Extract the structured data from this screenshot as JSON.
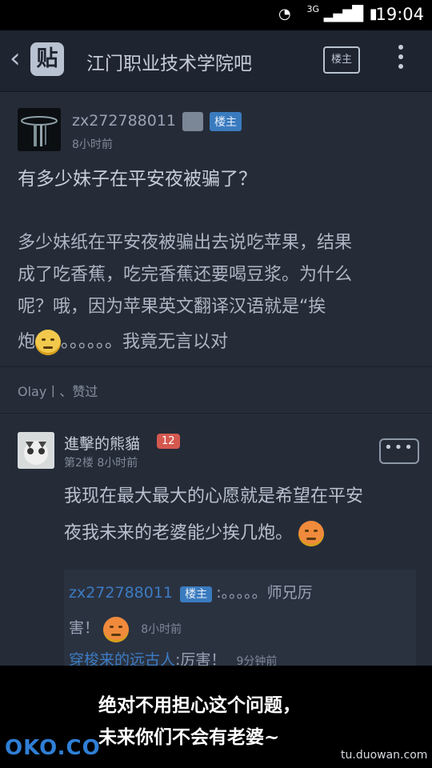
{
  "status_bar": {
    "time": "19:04",
    "network": "3G"
  },
  "header": {
    "logo_text": "贴",
    "title": "江门职业技术学院吧",
    "owner_button": "楼主"
  },
  "post": {
    "username": "zx272788011",
    "owner_badge": "楼主",
    "time": "8小时前",
    "title": "有多少妹子在平安夜被骗了？",
    "body_line1": "多少妹纸在平安夜被骗出去说吃苹果，结果",
    "body_line2": "成了吃香蕉，吃完香蕉还要喝豆浆。为什么",
    "body_line3": "呢？哦，因为苹果英文翻译汉语就是“挨",
    "body_line4_a": "炮",
    "body_line4_b": "。。。。。。我竟无言以对",
    "likes": "Olay丨、赞过"
  },
  "reply": {
    "username": "進擊的熊貓",
    "level": "12",
    "meta": "第2楼  8小时前",
    "text_line1": "我现在最大最大的心愿就是希望在平安",
    "text_line2": "夜我未来的老婆能少挨几炮。",
    "sub1_user": "zx272788011",
    "sub1_badge": "楼主",
    "sub1_text_a": ":。。。。。师兄厉",
    "sub1_text_b": "害！",
    "sub1_time": "8小时前",
    "sub2_user": "穿梭来的远古人",
    "sub2_text": ":厉害！",
    "sub2_time": "9分钟前"
  },
  "overlay": {
    "caption_line1": "绝对不用担心这个问题，",
    "caption_line2": "未来你们不会有老婆~",
    "watermark_left": "OKO.CO",
    "watermark_right": "tu.duowan.com"
  }
}
